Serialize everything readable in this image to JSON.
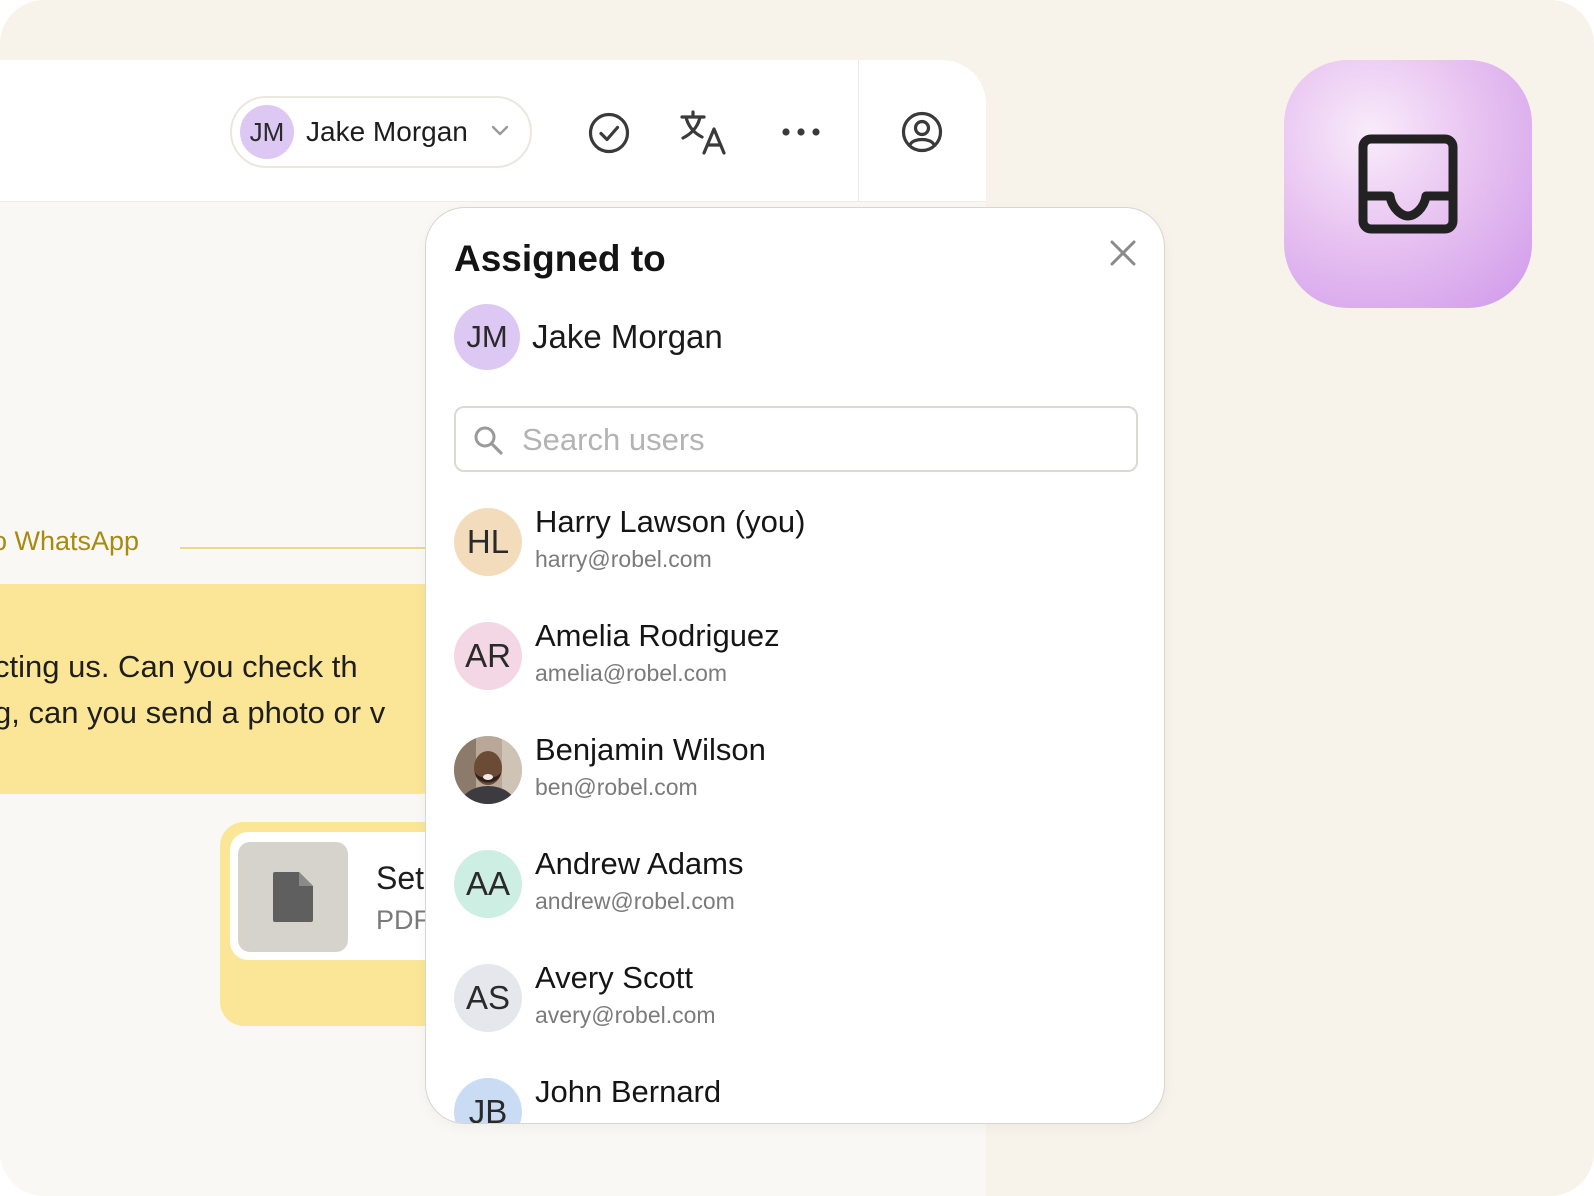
{
  "toolbar": {
    "assignee": {
      "initials": "JM",
      "name": "Jake Morgan",
      "avatar_color": "#dcc8f2"
    },
    "icons": [
      "check-circle-icon",
      "translate-icon",
      "more-icon",
      "user-circle-icon"
    ]
  },
  "conversation": {
    "channel_label": "o WhatsApp",
    "message_lines": [
      "cting us.  Can you check th",
      "g, can you send a photo or v"
    ],
    "attachment": {
      "name": "Set",
      "type": "PDF"
    }
  },
  "popover": {
    "title": "Assigned to",
    "current": {
      "initials": "JM",
      "name": "Jake Morgan",
      "avatar_color": "#dcc8f2"
    },
    "search_placeholder": "Search users",
    "users": [
      {
        "initials": "HL",
        "name": "Harry Lawson (you)",
        "email": "harry@robel.com",
        "avatar_color": "#f3dcbc"
      },
      {
        "initials": "AR",
        "name": "Amelia Rodriguez",
        "email": "amelia@robel.com",
        "avatar_color": "#f3d7e4"
      },
      {
        "initials": "",
        "name": "Benjamin Wilson",
        "email": "ben@robel.com",
        "avatar_color": "#8a6d58",
        "photo": true
      },
      {
        "initials": "AA",
        "name": "Andrew Adams",
        "email": "andrew@robel.com",
        "avatar_color": "#cdeee2"
      },
      {
        "initials": "AS",
        "name": "Avery Scott",
        "email": "avery@robel.com",
        "avatar_color": "#e6e7ec"
      },
      {
        "initials": "JB",
        "name": "John Bernard",
        "email": "",
        "avatar_color": "#c9dcf3"
      }
    ]
  },
  "side_tile": {
    "icon": "inbox-icon",
    "accent": "#d19eea"
  }
}
